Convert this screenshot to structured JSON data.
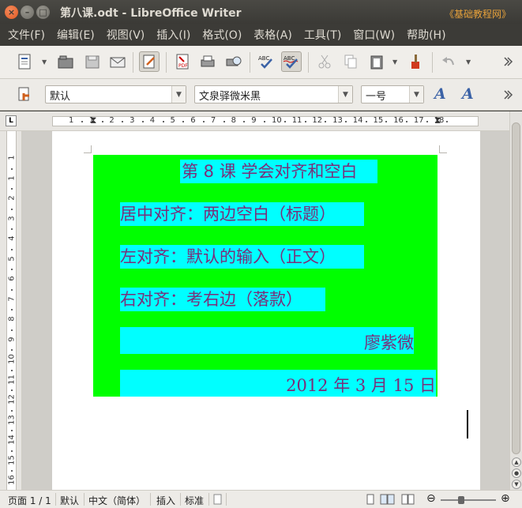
{
  "window": {
    "title": "第八课.odt - LibreOffice Writer",
    "watermark": "《基础教程网》"
  },
  "menu": {
    "items": [
      "文件(F)",
      "编辑(E)",
      "视图(V)",
      "插入(I)",
      "格式(O)",
      "表格(A)",
      "工具(T)",
      "窗口(W)",
      "帮助(H)"
    ]
  },
  "format_toolbar": {
    "style_value": "默认",
    "font_name_value": "文泉驿微米黑",
    "font_size_value": "一号"
  },
  "ruler": {
    "h_marks": [
      "1",
      "1",
      "2",
      "3",
      "4",
      "5",
      "6",
      "7",
      "8",
      "9",
      "10",
      "11",
      "12",
      "13",
      "14",
      "15",
      "16",
      "17",
      "18"
    ],
    "v_marks": [
      "1",
      "1",
      "2",
      "3",
      "4",
      "5",
      "6",
      "7",
      "8",
      "9",
      "10",
      "11",
      "12",
      "13",
      "14",
      "15",
      "16"
    ]
  },
  "document": {
    "lines": [
      "第 8 课  学会对齐和空白",
      "居中对齐：两边空白（标题）",
      "左对齐：默认的输入（正文）",
      "右对齐：考右边（落款）",
      "廖紫微",
      "2012 年 3 月 15 日"
    ],
    "highlight_color": "#00ffff",
    "background_color": "#00ff00",
    "text_color": "#7a2e7a"
  },
  "status": {
    "page": "页面 1 / 1",
    "style": "默认",
    "language": "中文（简体）",
    "insert_mode": "插入",
    "selection_mode": "标准"
  }
}
